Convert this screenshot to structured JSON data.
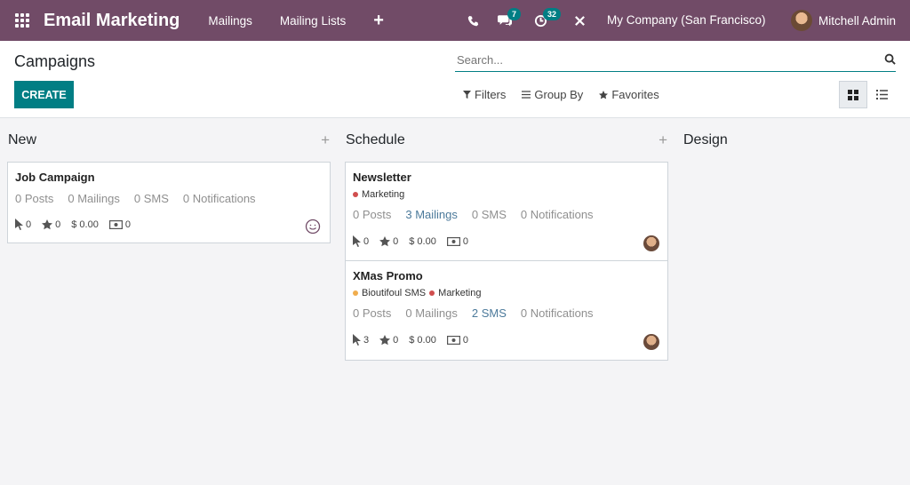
{
  "topbar": {
    "app_title": "Email Marketing",
    "menu": [
      "Mailings",
      "Mailing Lists"
    ],
    "messages_count": "7",
    "activities_count": "32",
    "company": "My Company (San Francisco)",
    "user": "Mitchell Admin"
  },
  "control_panel": {
    "title": "Campaigns",
    "create_label": "CREATE",
    "search_placeholder": "Search...",
    "filters_label": "Filters",
    "groupby_label": "Group By",
    "favorites_label": "Favorites"
  },
  "columns": [
    {
      "title": "New",
      "cards": [
        {
          "name": "Job Campaign",
          "tags": [],
          "posts": "0 Posts",
          "mailings": "0 Mailings",
          "sms": "0 SMS",
          "notifications": "0 Notifications",
          "clicks": "0",
          "rating": "0",
          "revenue": "$ 0.00",
          "money": "0"
        }
      ]
    },
    {
      "title": "Schedule",
      "cards": [
        {
          "name": "Newsletter",
          "tags": [
            {
              "label": "Marketing",
              "color": "#d04e4e"
            }
          ],
          "posts": "0 Posts",
          "mailings": "3 Mailings",
          "sms": "0 SMS",
          "notifications": "0 Notifications",
          "clicks": "0",
          "rating": "0",
          "revenue": "$ 0.00",
          "money": "0"
        },
        {
          "name": "XMas Promo",
          "tags": [
            {
              "label": "Bioutifoul SMS",
              "color": "#f0ad4e"
            },
            {
              "label": "Marketing",
              "color": "#d04e4e"
            }
          ],
          "posts": "0 Posts",
          "mailings": "0 Mailings",
          "sms": "2 SMS",
          "notifications": "0 Notifications",
          "clicks": "3",
          "rating": "0",
          "revenue": "$ 0.00",
          "money": "0"
        }
      ]
    },
    {
      "title": "Design",
      "cards": []
    }
  ],
  "colors": {
    "brand": "#714b67",
    "primary": "#017e84"
  }
}
